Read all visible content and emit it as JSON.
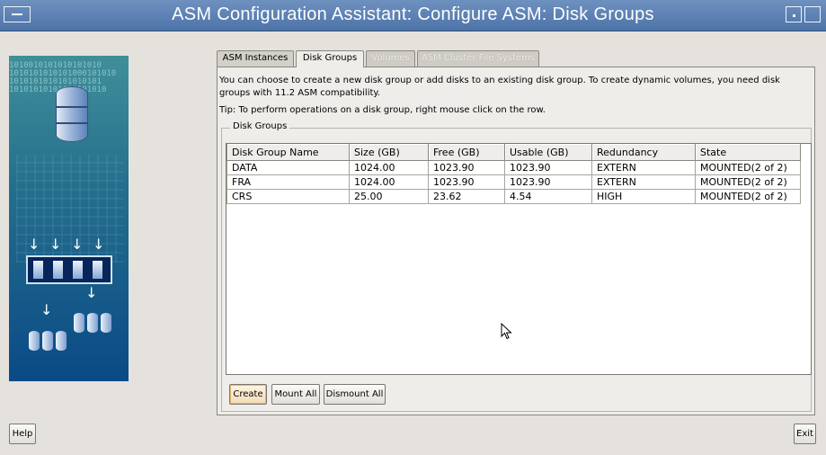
{
  "window": {
    "title": "ASM Configuration Assistant: Configure ASM: Disk Groups"
  },
  "illustration": {
    "bits": "1010010101010101010\n1010101010101000101010\n1010101010101010101\n10101010101010101010"
  },
  "tabs": [
    {
      "label": "ASM Instances",
      "state": "normal"
    },
    {
      "label": "Disk Groups",
      "state": "active"
    },
    {
      "label": "Volumes",
      "state": "disabled"
    },
    {
      "label": "ASM Cluster File Systems",
      "state": "disabled"
    }
  ],
  "content": {
    "description": "You can choose to create a new disk group or add disks to an existing disk group. To create dynamic volumes, you need disk groups with 11.2 ASM compatibility.",
    "tip": "Tip: To perform operations on a disk group, right mouse click on the row.",
    "group_title": "Disk Groups"
  },
  "table": {
    "columns": [
      "Disk Group Name",
      "Size (GB)",
      "Free (GB)",
      "Usable (GB)",
      "Redundancy",
      "State"
    ],
    "rows": [
      [
        "DATA",
        "1024.00",
        "1023.90",
        "1023.90",
        "EXTERN",
        "MOUNTED(2 of 2)"
      ],
      [
        "FRA",
        "1024.00",
        "1023.90",
        "1023.90",
        "EXTERN",
        "MOUNTED(2 of 2)"
      ],
      [
        "CRS",
        "25.00",
        "23.62",
        "4.54",
        "HIGH",
        "MOUNTED(2 of 2)"
      ]
    ]
  },
  "buttons": {
    "create": "Create",
    "mount_all": "Mount All",
    "dismount_all": "Dismount All",
    "help": "Help",
    "exit": "Exit"
  }
}
